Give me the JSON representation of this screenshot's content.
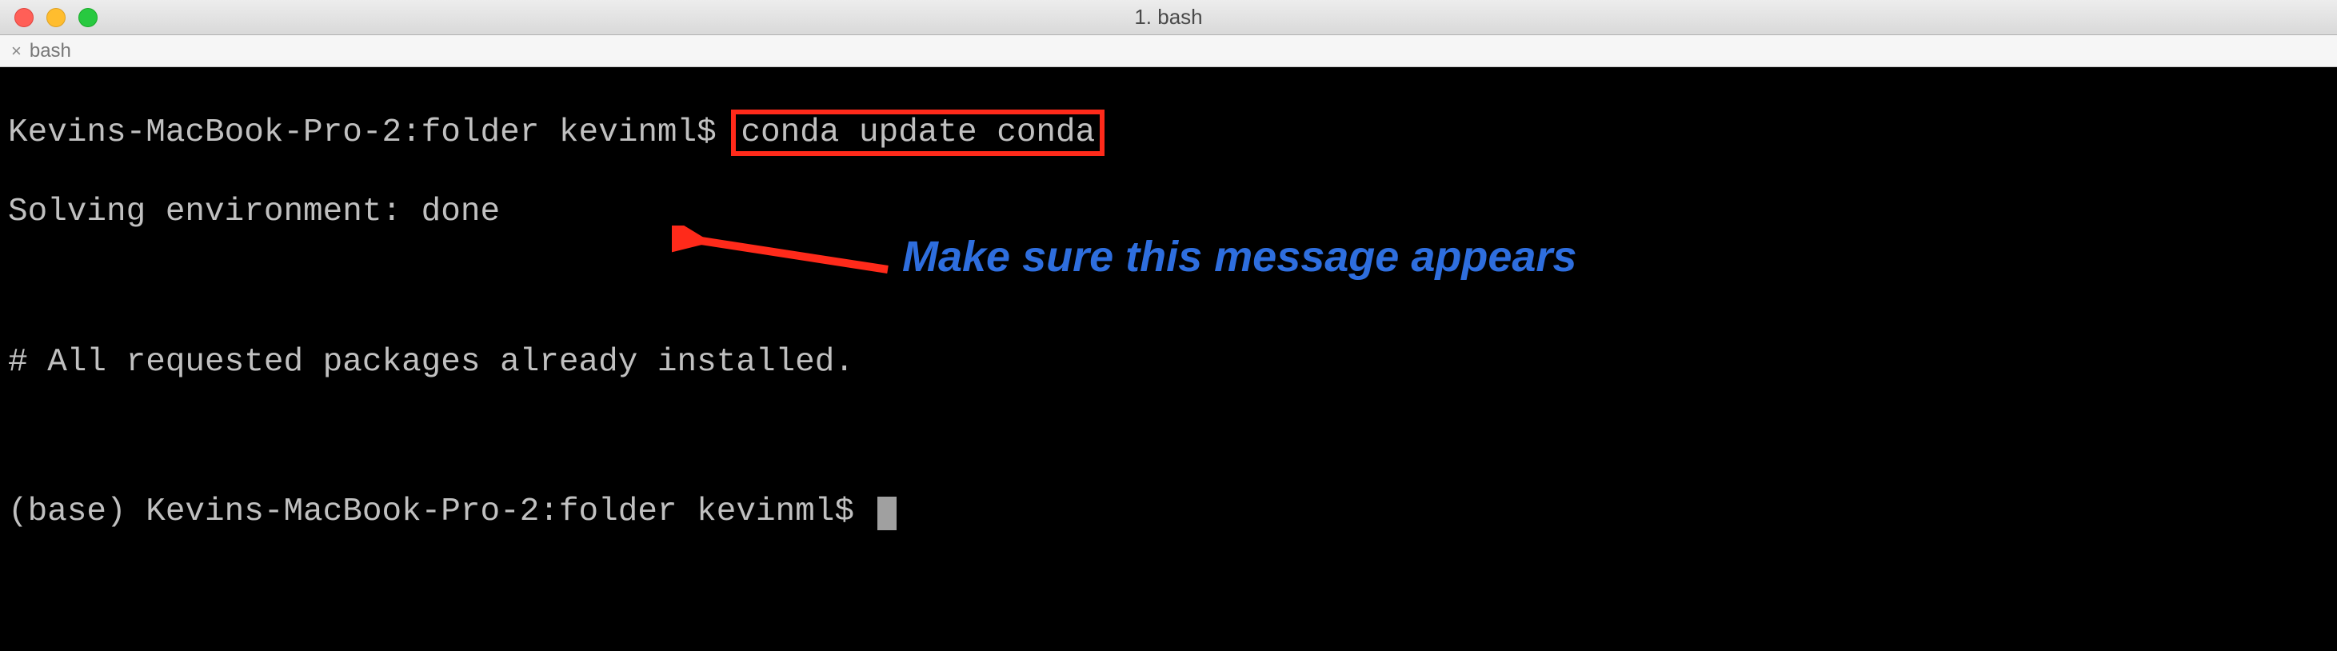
{
  "window": {
    "title": "1. bash"
  },
  "tab": {
    "label": "bash"
  },
  "terminal": {
    "line1_prompt": "Kevins-MacBook-Pro-2:folder kevinml$ ",
    "line1_command": "conda update conda",
    "line2": "Solving environment: done",
    "line3": "",
    "line4": "# All requested packages already installed.",
    "line5": "",
    "line6_prompt": "(base) Kevins-MacBook-Pro-2:folder kevinml$ "
  },
  "annotation": {
    "text": "Make sure this message appears"
  }
}
